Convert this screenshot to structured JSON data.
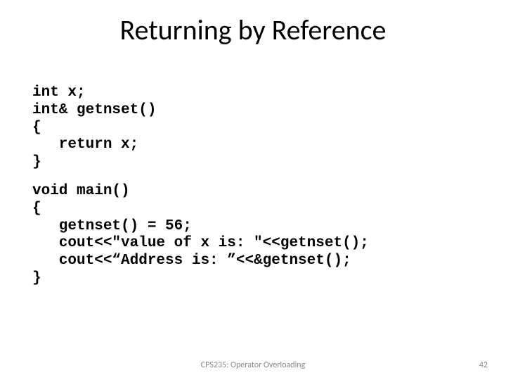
{
  "title": "Returning by Reference",
  "code": {
    "block1": "int x;\nint& getnset()\n{\n   return x;\n}",
    "block2": "void main()\n{\n   getnset() = 56;\n   cout<<\"value of x is: \"<<getnset();\n   cout<<“Address is: ”<<&getnset();\n}"
  },
  "footer": {
    "center": "CPS235: Operator Overloading",
    "page": "42"
  }
}
